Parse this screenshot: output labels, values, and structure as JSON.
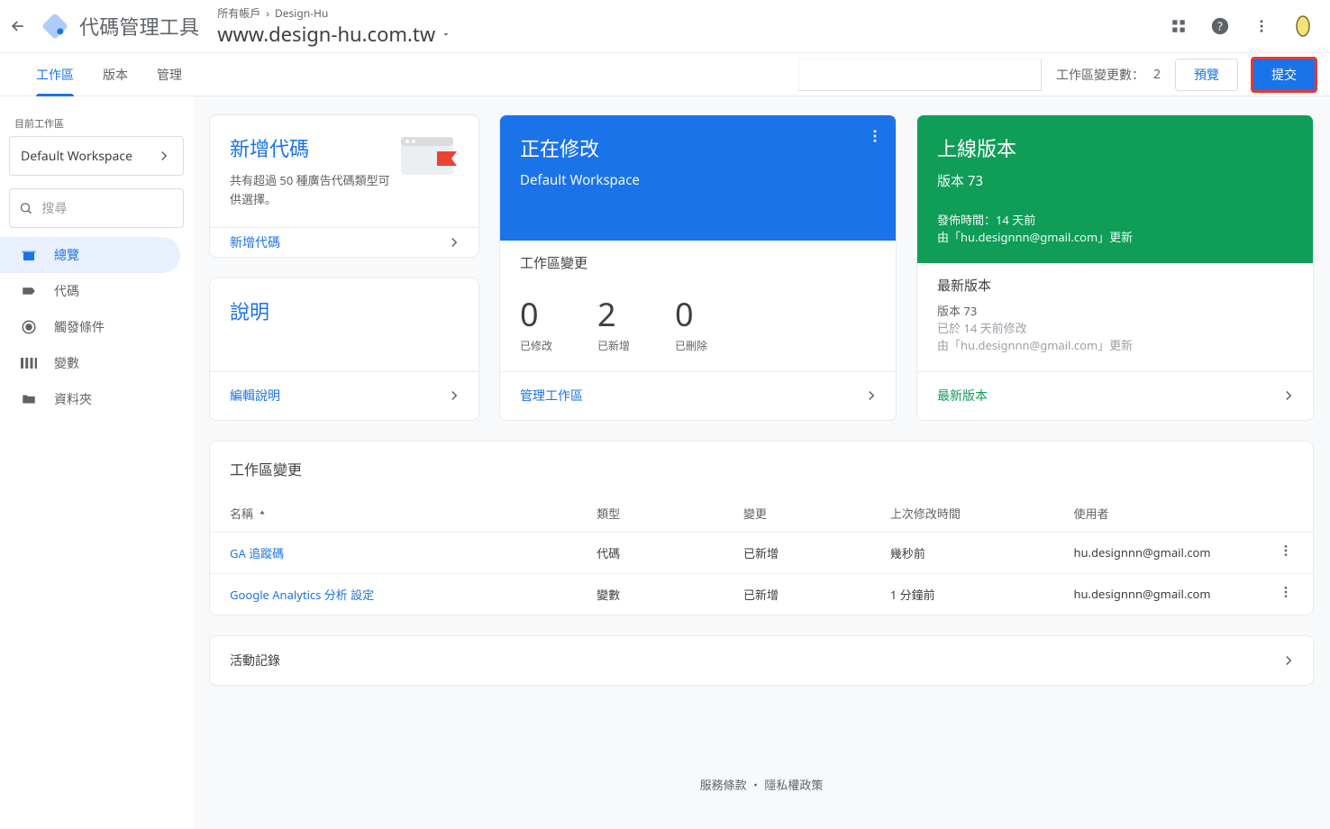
{
  "header": {
    "brand": "代碼管理工具",
    "breadcrumb_accounts": "所有帳戶",
    "breadcrumb_container": "Design-Hu",
    "container_name": "www.design-hu.com.tw"
  },
  "tabs": {
    "workspace": "工作區",
    "versions": "版本",
    "admin": "管理"
  },
  "tabbar_right": {
    "changes_label": "工作區變更數：",
    "changes_count": "2",
    "preview_label": "預覽",
    "submit_label": "提交"
  },
  "sidebar": {
    "current_workspace_label": "目前工作區",
    "workspace_name": "Default Workspace",
    "search_placeholder": "搜尋",
    "nav": [
      {
        "label": "總覽",
        "icon": "overview"
      },
      {
        "label": "代碼",
        "icon": "tag"
      },
      {
        "label": "觸發條件",
        "icon": "trigger"
      },
      {
        "label": "變數",
        "icon": "variable"
      },
      {
        "label": "資料夾",
        "icon": "folder"
      }
    ]
  },
  "cards": {
    "new_tag": {
      "title": "新增代碼",
      "desc": "共有超過 50 種廣告代碼類型可供選擇。",
      "action": "新增代碼"
    },
    "description": {
      "title": "說明",
      "action": "編輯說明"
    },
    "now_editing": {
      "title": "正在修改",
      "workspace": "Default Workspace",
      "section_title": "工作區變更",
      "stats": {
        "modified_num": "0",
        "modified_lbl": "已修改",
        "added_num": "2",
        "added_lbl": "已新增",
        "deleted_num": "0",
        "deleted_lbl": "已刪除"
      },
      "action": "管理工作區"
    },
    "live": {
      "title": "上線版本",
      "version_line": "版本 73",
      "published_line": "發佈時間：14 天前",
      "by_line": "由「hu.designnn@gmail.com」更新",
      "section_title": "最新版本",
      "latest_version": "版本 73",
      "latest_modified": "已於 14 天前修改",
      "latest_by": "由「hu.designnn@gmail.com」更新",
      "action": "最新版本"
    }
  },
  "changes_table": {
    "title": "工作區變更",
    "columns": {
      "name": "名稱",
      "type": "類型",
      "change": "變更",
      "last_modified": "上次修改時間",
      "user": "使用者"
    },
    "rows": [
      {
        "name": "GA 追蹤碼",
        "type": "代碼",
        "change": "已新增",
        "last_modified": "幾秒前",
        "user": "hu.designnn@gmail.com"
      },
      {
        "name": "Google Analytics 分析 設定",
        "type": "變數",
        "change": "已新增",
        "last_modified": "1 分鐘前",
        "user": "hu.designnn@gmail.com"
      }
    ]
  },
  "activity": {
    "title": "活動記錄"
  },
  "footer": {
    "terms": "服務條款",
    "privacy": "隱私權政策"
  }
}
